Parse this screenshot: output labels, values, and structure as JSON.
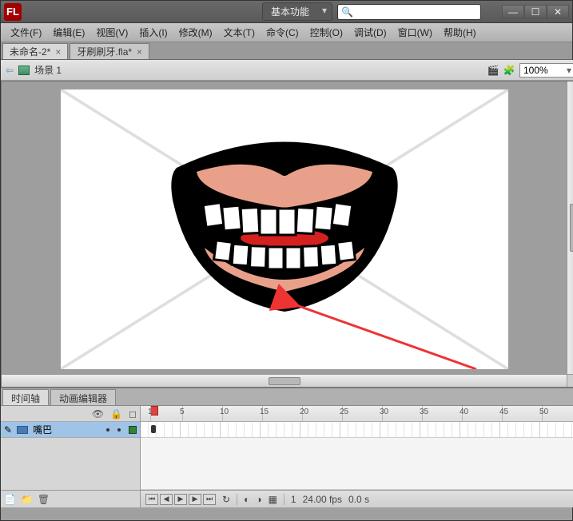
{
  "app": {
    "logo_text": "FL"
  },
  "workspace": {
    "label": "基本功能"
  },
  "search": {
    "placeholder": ""
  },
  "window_controls": {
    "min": "—",
    "max": "☐",
    "close": "✕"
  },
  "menu": [
    "文件(F)",
    "编辑(E)",
    "视图(V)",
    "插入(I)",
    "修改(M)",
    "文本(T)",
    "命令(C)",
    "控制(O)",
    "调试(D)",
    "窗口(W)",
    "帮助(H)"
  ],
  "tabs": [
    {
      "label": "未命名-2*",
      "active": true
    },
    {
      "label": "牙刷刷牙.fla*",
      "active": false
    }
  ],
  "scene": {
    "name": "场景 1",
    "zoom": "100%"
  },
  "timeline": {
    "tabs": [
      "时间轴",
      "动画编辑器"
    ],
    "layer_name": "嘴巴",
    "ruler_marks": [
      1,
      5,
      10,
      15,
      20,
      25,
      30,
      35,
      40,
      45,
      50
    ],
    "current_frame": "1",
    "fps": "24.00 fps",
    "elapsed": "0.0 s"
  },
  "right_panel_icons": [
    "palette",
    "swatches",
    "props",
    "library",
    "info",
    "transform",
    "align",
    "color",
    "sample",
    "history",
    "components",
    "motion"
  ],
  "tools": [
    "selection",
    "subselect",
    "free-transform",
    "3d-rotate",
    "lasso",
    "pen",
    "text",
    "line",
    "rectangle",
    "pencil",
    "brush",
    "deco",
    "bone",
    "paint-bucket",
    "ink-bottle",
    "eyedropper",
    "eraser",
    "hand",
    "zoom"
  ],
  "colors": {
    "stroke": "#000000",
    "fill": "#0033cc"
  }
}
